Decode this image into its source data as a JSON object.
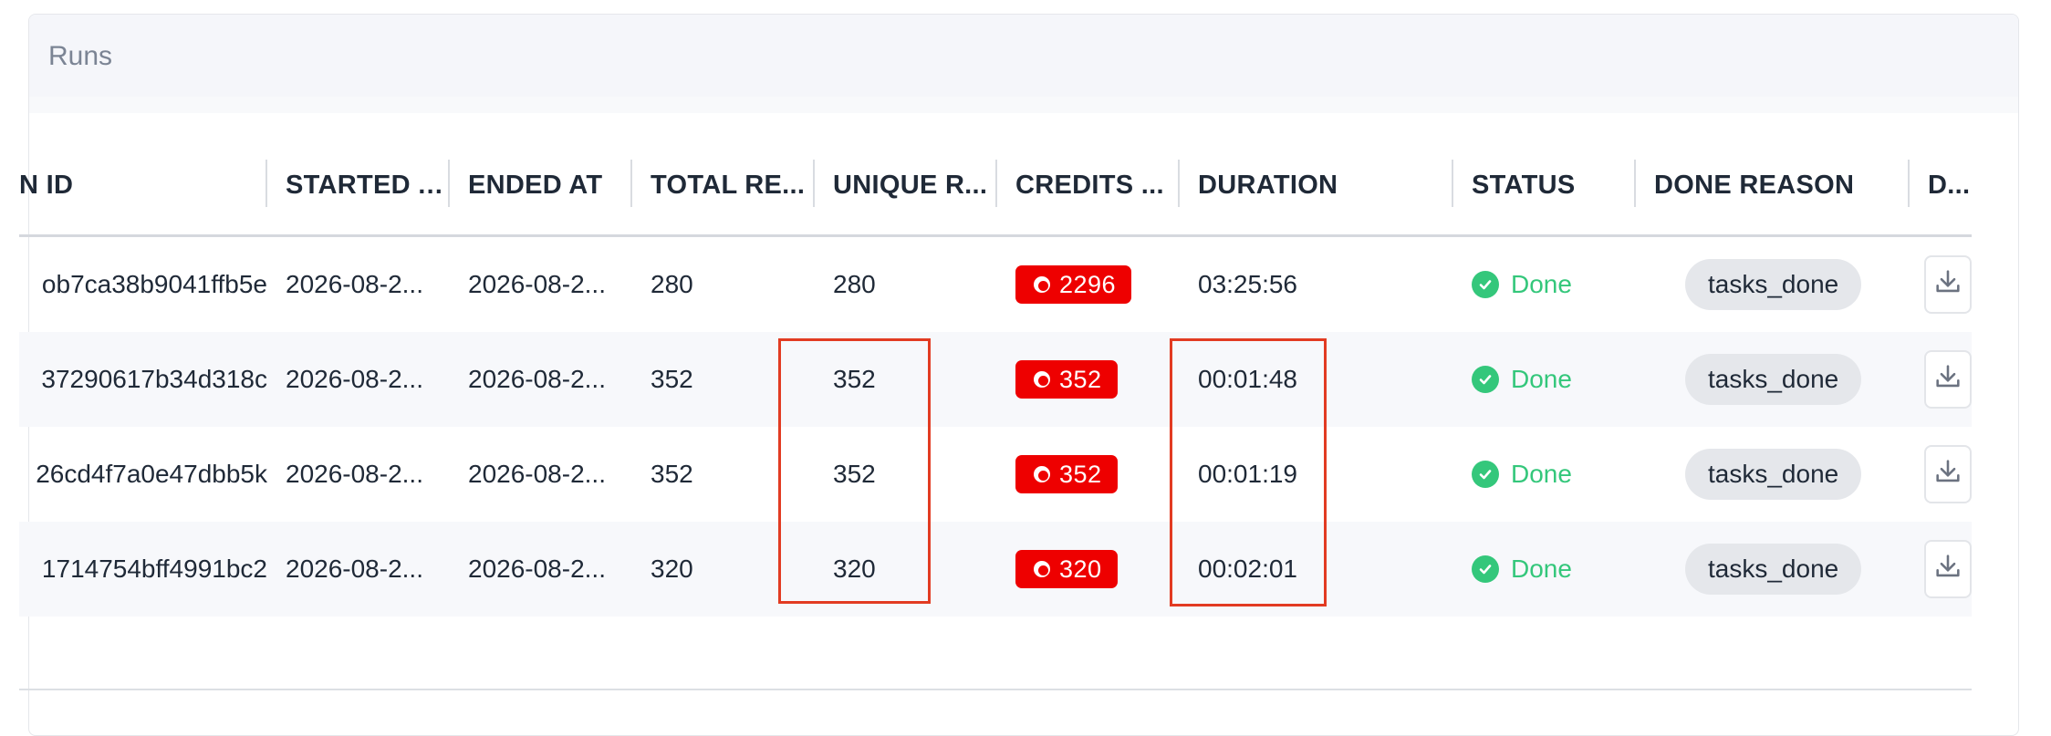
{
  "panel": {
    "title": "Runs"
  },
  "table": {
    "columns": [
      {
        "key": "run_id",
        "label": "N ID"
      },
      {
        "key": "started_at",
        "label": "STARTED AT"
      },
      {
        "key": "ended_at",
        "label": "ENDED AT"
      },
      {
        "key": "total",
        "label": "TOTAL RE..."
      },
      {
        "key": "unique",
        "label": "UNIQUE R..."
      },
      {
        "key": "credits",
        "label": "CREDITS ..."
      },
      {
        "key": "duration",
        "label": "DURATION"
      },
      {
        "key": "status",
        "label": "STATUS"
      },
      {
        "key": "done_reason",
        "label": "DONE REASON"
      },
      {
        "key": "download",
        "label": "D..."
      }
    ],
    "rows": [
      {
        "run_id": "ob7ca38b9041ffb5e",
        "started_at": "2026-08-2...",
        "ended_at": "2026-08-2...",
        "total": "280",
        "unique": "280",
        "credits": "2296",
        "duration": "03:25:56",
        "status": "Done",
        "done_reason": "tasks_done"
      },
      {
        "run_id": "37290617b34d318c",
        "started_at": "2026-08-2...",
        "ended_at": "2026-08-2...",
        "total": "352",
        "unique": "352",
        "credits": "352",
        "duration": "00:01:48",
        "status": "Done",
        "done_reason": "tasks_done"
      },
      {
        "run_id": "26cd4f7a0e47dbb5k",
        "started_at": "2026-08-2...",
        "ended_at": "2026-08-2...",
        "total": "352",
        "unique": "352",
        "credits": "352",
        "duration": "00:01:19",
        "status": "Done",
        "done_reason": "tasks_done"
      },
      {
        "run_id": "1714754bff4991bc2",
        "started_at": "2026-08-2...",
        "ended_at": "2026-08-2...",
        "total": "320",
        "unique": "320",
        "credits": "320",
        "duration": "00:02:01",
        "status": "Done",
        "done_reason": "tasks_done"
      }
    ]
  },
  "icons": {
    "credits": "coin-icon",
    "status": "check-circle-icon",
    "download": "download-icon"
  },
  "colors": {
    "credit_badge": "#ee0000",
    "status_done": "#34c77b",
    "highlight": "#e23b22"
  }
}
